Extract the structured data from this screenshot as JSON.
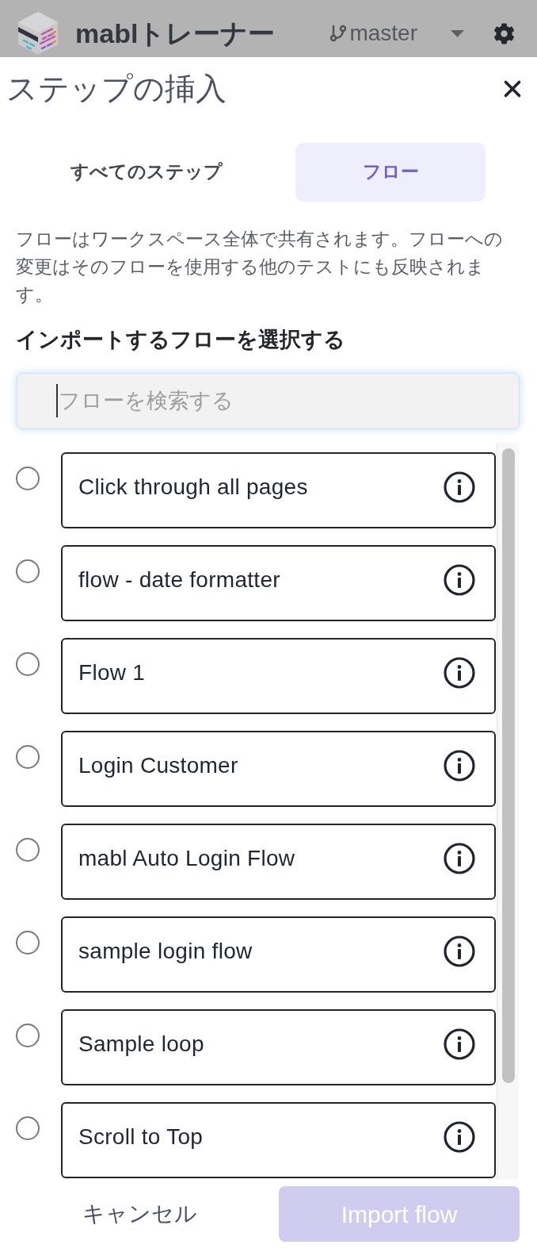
{
  "app_bar": {
    "title": "mablトレーナー",
    "branch": "master"
  },
  "dialog": {
    "title": "ステップの挿入"
  },
  "tabs": [
    {
      "label": "すべてのステップ",
      "selected": false
    },
    {
      "label": "フロー",
      "selected": true
    }
  ],
  "description": "フローはワークスペース全体で共有されます。フローへの変更はそのフローを使用する他のテストにも反映されます。",
  "list_heading": "インポートするフローを選択する",
  "search": {
    "placeholder": "フローを検索する",
    "focused": true
  },
  "flows": [
    {
      "name": "Click through all pages",
      "selected": false
    },
    {
      "name": "flow - date formatter",
      "selected": false
    },
    {
      "name": "Flow 1",
      "selected": false
    },
    {
      "name": "Login Customer",
      "selected": false
    },
    {
      "name": "mabl Auto Login Flow",
      "selected": false
    },
    {
      "name": "sample login flow",
      "selected": false
    },
    {
      "name": "Sample loop",
      "selected": false
    },
    {
      "name": "Scroll to Top",
      "selected": false
    }
  ],
  "buttons": {
    "cancel": {
      "label": "キャンセル"
    },
    "import": {
      "label": "Import flow",
      "disabled": true
    }
  }
}
